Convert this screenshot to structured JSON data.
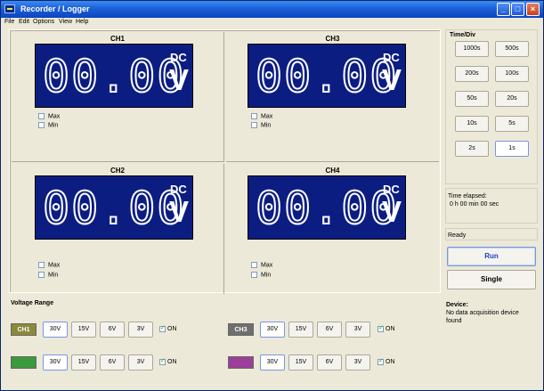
{
  "window": {
    "title": "Recorder / Logger"
  },
  "menu": [
    "File",
    "Edit",
    "Options",
    "View",
    "Help"
  ],
  "channels": [
    {
      "name": "CH1",
      "reading": "00.00",
      "coupling": "DC",
      "unit": "V",
      "max_label": "Max",
      "min_label": "Min"
    },
    {
      "name": "CH3",
      "reading": "00.00",
      "coupling": "DC",
      "unit": "V",
      "max_label": "Max",
      "min_label": "Min"
    },
    {
      "name": "CH2",
      "reading": "00.00",
      "coupling": "DC",
      "unit": "V",
      "max_label": "Max",
      "min_label": "Min"
    },
    {
      "name": "CH4",
      "reading": "00.00",
      "coupling": "DC",
      "unit": "V",
      "max_label": "Max",
      "min_label": "Min"
    }
  ],
  "voltage_range": {
    "title": "Voltage Range",
    "rows": [
      {
        "tag": "CH1",
        "tag_color": "#8a8a3a",
        "buttons": [
          "30V",
          "15V",
          "6V",
          "3V"
        ],
        "on_label": "ON"
      },
      {
        "tag": "CH3",
        "tag_color": "#6f6f6f",
        "buttons": [
          "30V",
          "15V",
          "6V",
          "3V"
        ],
        "on_label": "ON"
      },
      {
        "tag": "",
        "tag_color": "#3b9a3b",
        "buttons": [
          "30V",
          "15V",
          "6V",
          "3V"
        ],
        "on_label": "ON"
      },
      {
        "tag": "",
        "tag_color": "#9b3f9b",
        "buttons": [
          "30V",
          "15V",
          "6V",
          "3V"
        ],
        "on_label": "ON"
      }
    ]
  },
  "time_div": {
    "title": "Time/Div",
    "buttons": [
      "1000s",
      "500s",
      "200s",
      "100s",
      "50s",
      "20s",
      "10s",
      "5s",
      "2s",
      "1s"
    ]
  },
  "time_elapsed": {
    "label": "Time elapsed:",
    "value": "0 h 00 min 00 sec"
  },
  "status": "Ready",
  "run_label": "Run",
  "single_label": "Single",
  "device": {
    "heading": "Device:",
    "text": "No data acquisition device found"
  },
  "colors": {
    "display_bg": "#0c1d82",
    "titlebar": "#0b45c0",
    "run_text": "#1f3fbf"
  }
}
